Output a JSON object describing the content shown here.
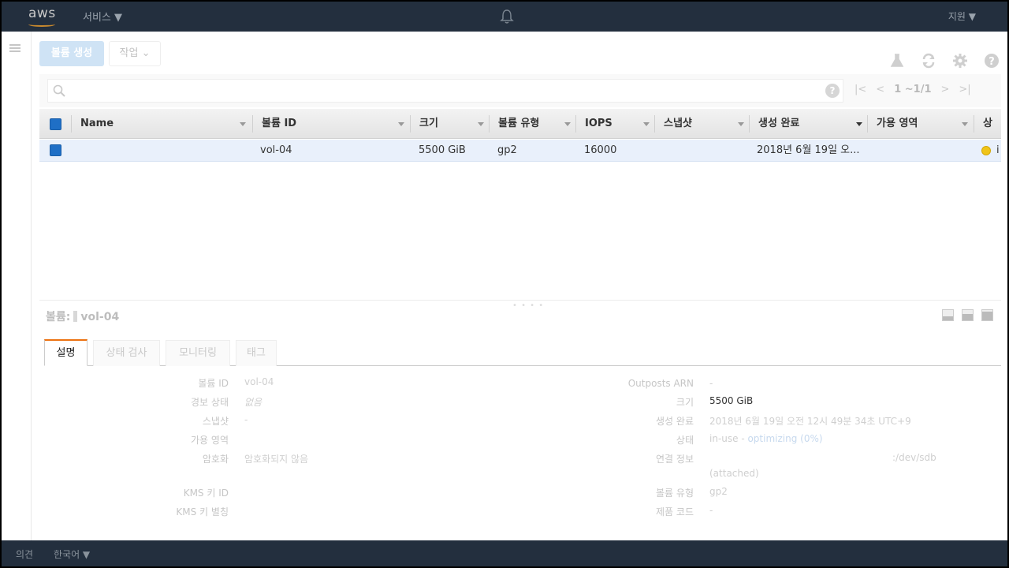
{
  "nav": {
    "logo": "aws",
    "services": "서비스 ▼",
    "support": "지원 ▼"
  },
  "footer": {
    "feedback": "의견",
    "language": "한국어 ▼"
  },
  "toolbar": {
    "create_volume": "볼륨 생성",
    "actions": "작업 ⌄"
  },
  "search": {
    "placeholder": "",
    "help": "?",
    "pagination": "1 ~1/1"
  },
  "table": {
    "columns": [
      "Name",
      "볼륨 ID",
      "크기",
      "볼륨 유형",
      "IOPS",
      "스냅샷",
      "생성 완료",
      "가용 영역",
      "상태"
    ],
    "rows": [
      {
        "name": "",
        "volume_id": "vol-04",
        "size": "5500 GiB",
        "type": "gp2",
        "iops": "16000",
        "snapshot": "",
        "created": "2018년 6월 19일 오...",
        "az": "",
        "state": "i"
      }
    ]
  },
  "detail": {
    "title_prefix": "볼륨:",
    "title_value": "vol-04",
    "tabs": [
      "설명",
      "상태 검사",
      "모니터링",
      "태그"
    ],
    "left": [
      {
        "k": "볼륨 ID",
        "v": "vol-04"
      },
      {
        "k": "경보 상태",
        "v": "없음"
      },
      {
        "k": "스냅샷",
        "v": "-"
      },
      {
        "k": "가용 영역",
        "v": ""
      },
      {
        "k": "암호화",
        "v": "암호화되지 않음"
      },
      {
        "k": "KMS 키 ID",
        "v": ""
      },
      {
        "k": "KMS 키 별칭",
        "v": ""
      }
    ],
    "right": [
      {
        "k": "Outposts ARN",
        "v": "-"
      },
      {
        "k": "크기",
        "v": "5500 GiB"
      },
      {
        "k": "생성 완료",
        "v": "2018년 6월 19일 오전 12시 49분 34초 UTC+9"
      },
      {
        "k": "상태",
        "v": "in-use - ",
        "v2": "optimizing (0%)"
      },
      {
        "k": "연결 정보",
        "v": ":/dev/sdb",
        "v2": "(attached)"
      },
      {
        "k": "볼륨 유형",
        "v": "gp2"
      },
      {
        "k": "제품 코드",
        "v": "-"
      }
    ]
  },
  "colors": {
    "nav_bg": "#232f3e",
    "accent": "#ec7211",
    "selected_row": "#e9f0fb",
    "checkbox": "#1f6fc6",
    "state_dot": "#f0c419"
  }
}
